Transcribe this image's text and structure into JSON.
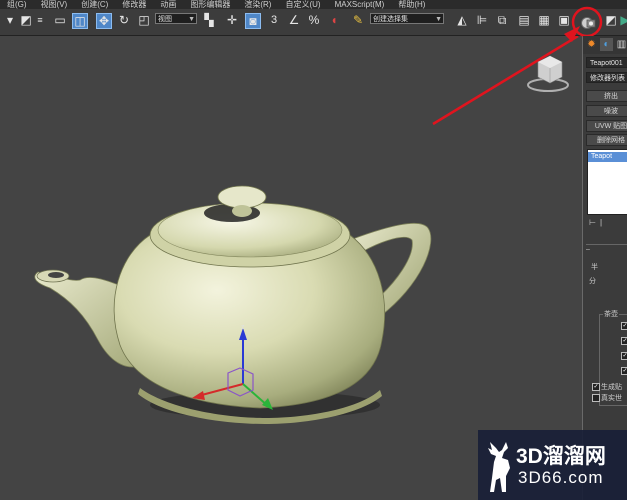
{
  "menu": [
    "组(G)",
    "视图(V)",
    "创建(C)",
    "修改器",
    "动画",
    "图形编辑器",
    "渲染(R)",
    "自定义(U)",
    "MAXScript(M)",
    "帮助(H)"
  ],
  "toolbar": {
    "view_dropdown": "视图",
    "selection_set_dropdown": "创建选择集",
    "snap_label": "3",
    "angle_snap_label": "∠",
    "percent_snap_label": "%"
  },
  "command_panel": {
    "object_name": "Teapot001",
    "modifier_list": "修改器列表",
    "buttons": [
      "挤出",
      "噪波",
      "UVW 贴图",
      "删除网格"
    ],
    "stack_item": "Teapot",
    "params": {
      "segments_label": "半",
      "divisions_label": "分",
      "teapot_parts_label": "茶壶",
      "gen_mapping": "生成贴",
      "real_world": "真实世"
    },
    "checkboxes": {
      "gen_mapping": true,
      "real_world": false
    }
  },
  "viewport": {
    "gizmo_z_label": "z"
  },
  "watermark": {
    "logo_text": "3D溜溜网",
    "url_text": "3D66.com"
  },
  "annotation": {
    "color": "#e0141e",
    "highlight_target": "render-setup-icon"
  }
}
